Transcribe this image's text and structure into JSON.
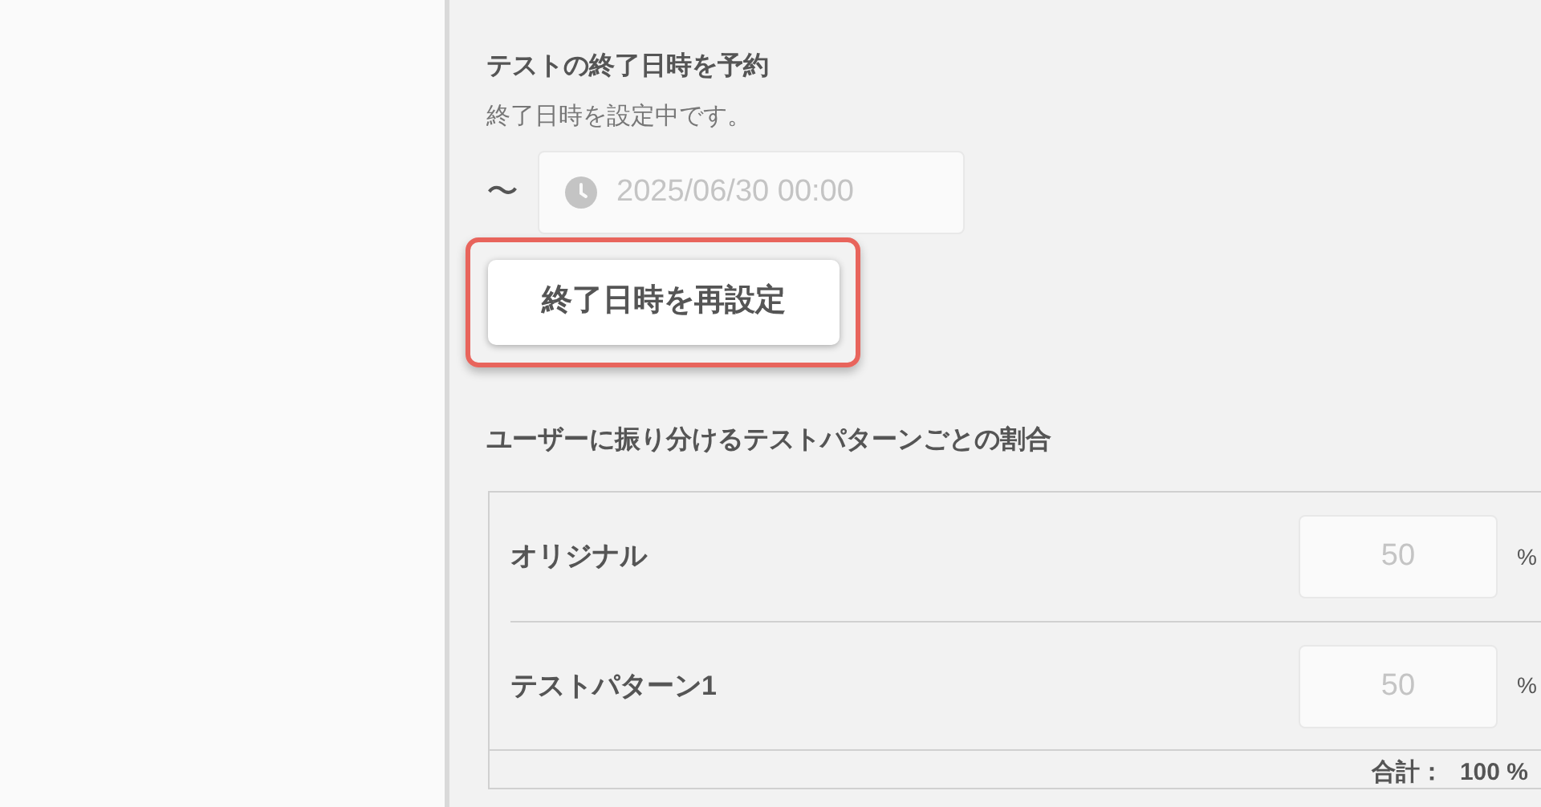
{
  "schedule": {
    "title": "テストの終了日時を予約",
    "status": "終了日時を設定中です。",
    "range_mark": "〜",
    "end_field": {
      "value": "2025/06/30 00:00",
      "disabled": true
    },
    "reset_button": {
      "label": "終了日時を再設定",
      "highlighted": true
    }
  },
  "ratio": {
    "title": "ユーザーに振り分けるテストパターンごとの割合",
    "rows": [
      {
        "name": "オリジナル",
        "value": "50",
        "unit": "%",
        "disabled": true
      },
      {
        "name": "テストパターン1",
        "value": "50",
        "unit": "%",
        "disabled": true
      }
    ],
    "total_label": "合計：",
    "total_value": "100 %"
  }
}
